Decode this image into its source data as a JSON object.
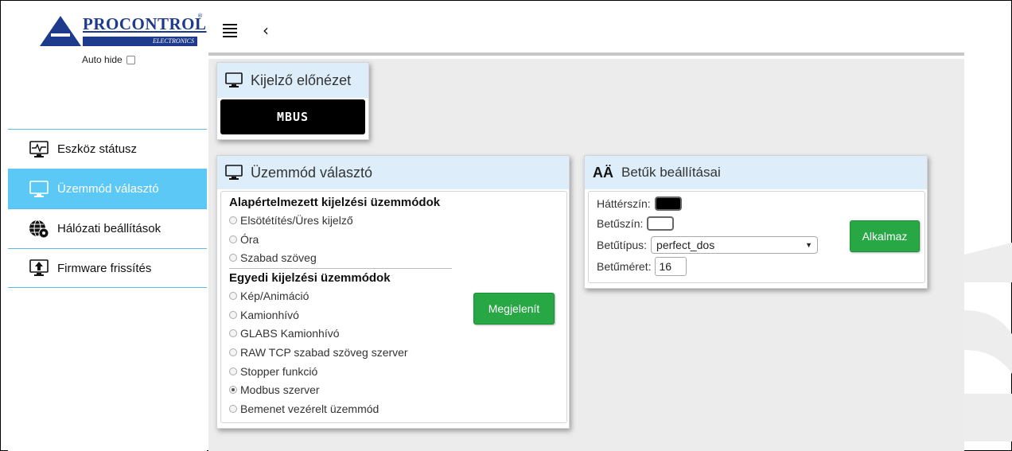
{
  "brand": {
    "name": "PROCONTROL",
    "sub": "ELECTRONICS",
    "reg": "®"
  },
  "sidebar": {
    "auto_hide_label": "Auto hide",
    "items": [
      {
        "label": "Eszköz státusz",
        "icon": "monitor-pulse-icon"
      },
      {
        "label": "Üzemmód választó",
        "icon": "monitor-icon",
        "active": true
      },
      {
        "label": "Hálózati beállítások",
        "icon": "network-settings-icon"
      },
      {
        "label": "Firmware frissítés",
        "icon": "upload-icon"
      }
    ]
  },
  "topbar": {
    "menu_icon": "hamburger-icon",
    "back_icon": "chevron-left-icon"
  },
  "preview": {
    "title": "Kijelző előnézet",
    "display_text": "MBUS"
  },
  "mode": {
    "title": "Üzemmód választó",
    "default_group": "Alapértelmezett kijelzési üzemmódok",
    "default_options": [
      "Elsötétítés/Üres kijelző",
      "Óra",
      "Szabad szöveg"
    ],
    "custom_group": "Egyedi kijelzési üzemmódok",
    "custom_options": [
      "Kép/Animáció",
      "Kamionhívó",
      "GLABS Kamionhívó",
      "RAW TCP szabad szöveg szerver",
      "Stopper funkció",
      "Modbus szerver",
      "Bemenet vezérelt üzemmód"
    ],
    "selected": "Modbus szerver",
    "button": "Megjelenít"
  },
  "font_settings": {
    "icon_text": "AÄ",
    "title": "Betűk beállításai",
    "bg_label": "Háttérszín:",
    "bg_color": "#000000",
    "fg_label": "Betűszín:",
    "fg_color": "#ffffff",
    "type_label": "Betűtípus:",
    "type_value": "perfect_dos",
    "size_label": "Betűméret:",
    "size_value": "16",
    "button": "Alkalmaz"
  },
  "colors": {
    "accent": "#5bc8f5",
    "button_green": "#28a745",
    "panel_head": "#ddeefa",
    "brand_blue": "#1d3a8c"
  }
}
